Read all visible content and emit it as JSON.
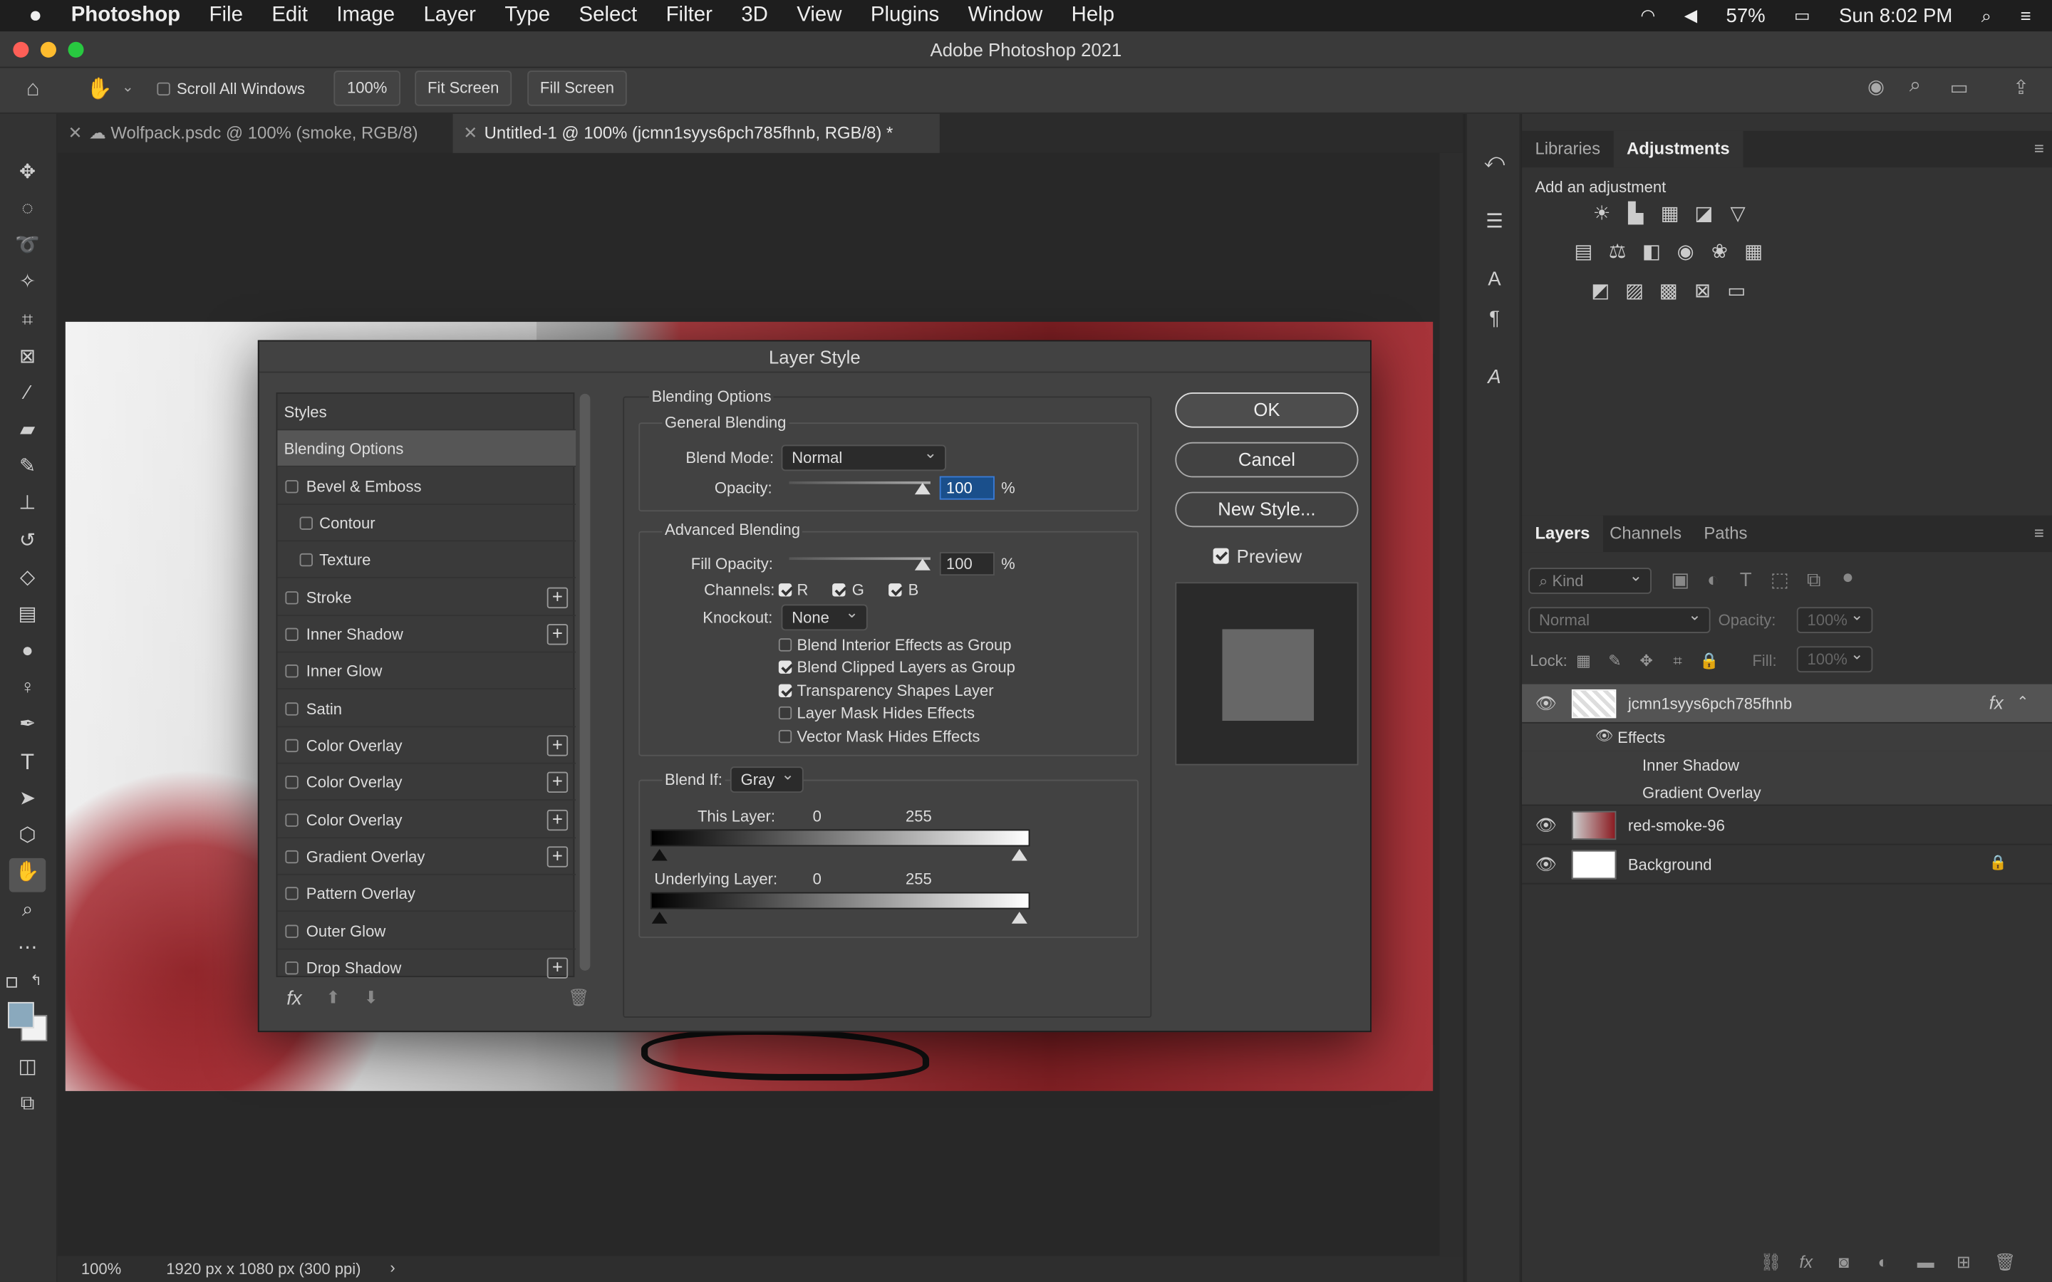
{
  "menubar": {
    "app": "Photoshop",
    "items": [
      "File",
      "Edit",
      "Image",
      "Layer",
      "Type",
      "Select",
      "Filter",
      "3D",
      "View",
      "Plugins",
      "Window",
      "Help"
    ],
    "battery": "57%",
    "clock": "Sun 8:02 PM"
  },
  "window": {
    "title": "Adobe Photoshop 2021"
  },
  "options": {
    "scroll_all": "Scroll All Windows",
    "zoom": "100%",
    "fit_screen": "Fit Screen",
    "fill_screen": "Fill Screen"
  },
  "tabs": [
    {
      "label": "Wolfpack.psdc @ 100% (smoke, RGB/8)"
    },
    {
      "label": "Untitled-1 @ 100% (jcmn1syys6pch785fhnb, RGB/8) *"
    }
  ],
  "status": {
    "zoom": "100%",
    "size": "1920 px x 1080 px (300 ppi)"
  },
  "adjustments_panel": {
    "tab_libraries": "Libraries",
    "tab_adjustments": "Adjustments",
    "hint": "Add an adjustment"
  },
  "layers_panel": {
    "tab_layers": "Layers",
    "tab_channels": "Channels",
    "tab_paths": "Paths",
    "filter_kind": "Kind",
    "blend": "Normal",
    "opacity_label": "Opacity:",
    "opacity": "100%",
    "lock_label": "Lock:",
    "fill_label": "Fill:",
    "fill": "100%",
    "layers": [
      {
        "name": "jcmn1syys6pch785fhnb",
        "effects_label": "Effects",
        "effects": [
          "Inner Shadow",
          "Gradient Overlay"
        ]
      },
      {
        "name": "red-smoke-96"
      },
      {
        "name": "Background"
      }
    ]
  },
  "dialog": {
    "title": "Layer Style",
    "styles": [
      "Styles",
      "Blending Options",
      "Bevel & Emboss",
      "Contour",
      "Texture",
      "Stroke",
      "Inner Shadow",
      "Inner Glow",
      "Satin",
      "Color Overlay",
      "Color Overlay",
      "Color Overlay",
      "Gradient Overlay",
      "Pattern Overlay",
      "Outer Glow",
      "Drop Shadow"
    ],
    "section": "Blending Options",
    "general": "General Blending",
    "blend_mode_label": "Blend Mode:",
    "blend_mode": "Normal",
    "opacity_label": "Opacity:",
    "opacity": "100",
    "pct": "%",
    "advanced": "Advanced Blending",
    "fill_opacity_label": "Fill Opacity:",
    "fill_opacity": "100",
    "channels_label": "Channels:",
    "ch_r": "R",
    "ch_g": "G",
    "ch_b": "B",
    "knockout_label": "Knockout:",
    "knockout": "None",
    "options": [
      "Blend Interior Effects as Group",
      "Blend Clipped Layers as Group",
      "Transparency Shapes Layer",
      "Layer Mask Hides Effects",
      "Vector Mask Hides Effects"
    ],
    "blend_if_label": "Blend If:",
    "blend_if": "Gray",
    "this_layer": "This Layer:",
    "underlying": "Underlying Layer:",
    "lo": "0",
    "hi": "255",
    "ok": "OK",
    "cancel": "Cancel",
    "new_style": "New Style...",
    "preview": "Preview",
    "fx": "fx"
  }
}
